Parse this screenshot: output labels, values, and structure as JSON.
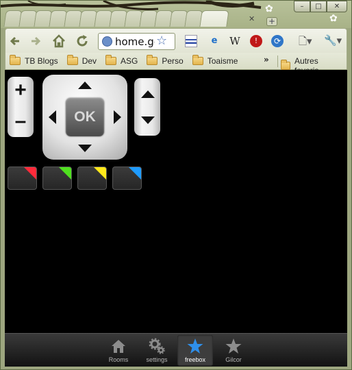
{
  "browser": {
    "tab_close_icon": "close-icon",
    "new_tab_icon": "new-tab-icon",
    "window_buttons": [
      "minimize-icon",
      "maximize-icon",
      "close-icon"
    ],
    "window_button_glyphs": [
      "–",
      "□",
      "✕"
    ]
  },
  "toolbar": {
    "back_icon": "back-arrow-icon",
    "forward_icon": "forward-arrow-icon",
    "home_icon": "home-icon",
    "reload_icon": "reload-icon",
    "address_value": "home.gc",
    "bookmark_star_icon": "star-icon",
    "extensions": [
      "flag-icon",
      "ie-tab-icon",
      "wikipedia-icon",
      "adblock-stop-icon",
      "sync-icon"
    ],
    "extension_glyphs": {
      "wikipedia": "W",
      "ie": "e"
    },
    "page_menu_icon": "page-menu-icon",
    "wrench_menu_icon": "wrench-icon"
  },
  "bookmarks": {
    "items": [
      {
        "label": "TB Blogs"
      },
      {
        "label": "Dev"
      },
      {
        "label": "ASG"
      },
      {
        "label": "Perso"
      },
      {
        "label": "Toaisme"
      }
    ],
    "overflow": "»",
    "other": "Autres favoris"
  },
  "remote": {
    "volume_up": "+",
    "volume_down": "–",
    "ok_label": "OK",
    "color_buttons": [
      {
        "name": "red",
        "color": "#ff2a3a"
      },
      {
        "name": "green",
        "color": "#4fe01f"
      },
      {
        "name": "yellow",
        "color": "#ffe81a"
      },
      {
        "name": "blue",
        "color": "#1e9bff"
      }
    ]
  },
  "tabbar": {
    "items": [
      {
        "label": "Rooms",
        "icon": "house-icon"
      },
      {
        "label": "settings",
        "icon": "gears-icon"
      },
      {
        "label": "freebox",
        "icon": "star-icon",
        "active": true
      },
      {
        "label": "Gilcor",
        "icon": "star-icon"
      }
    ]
  }
}
